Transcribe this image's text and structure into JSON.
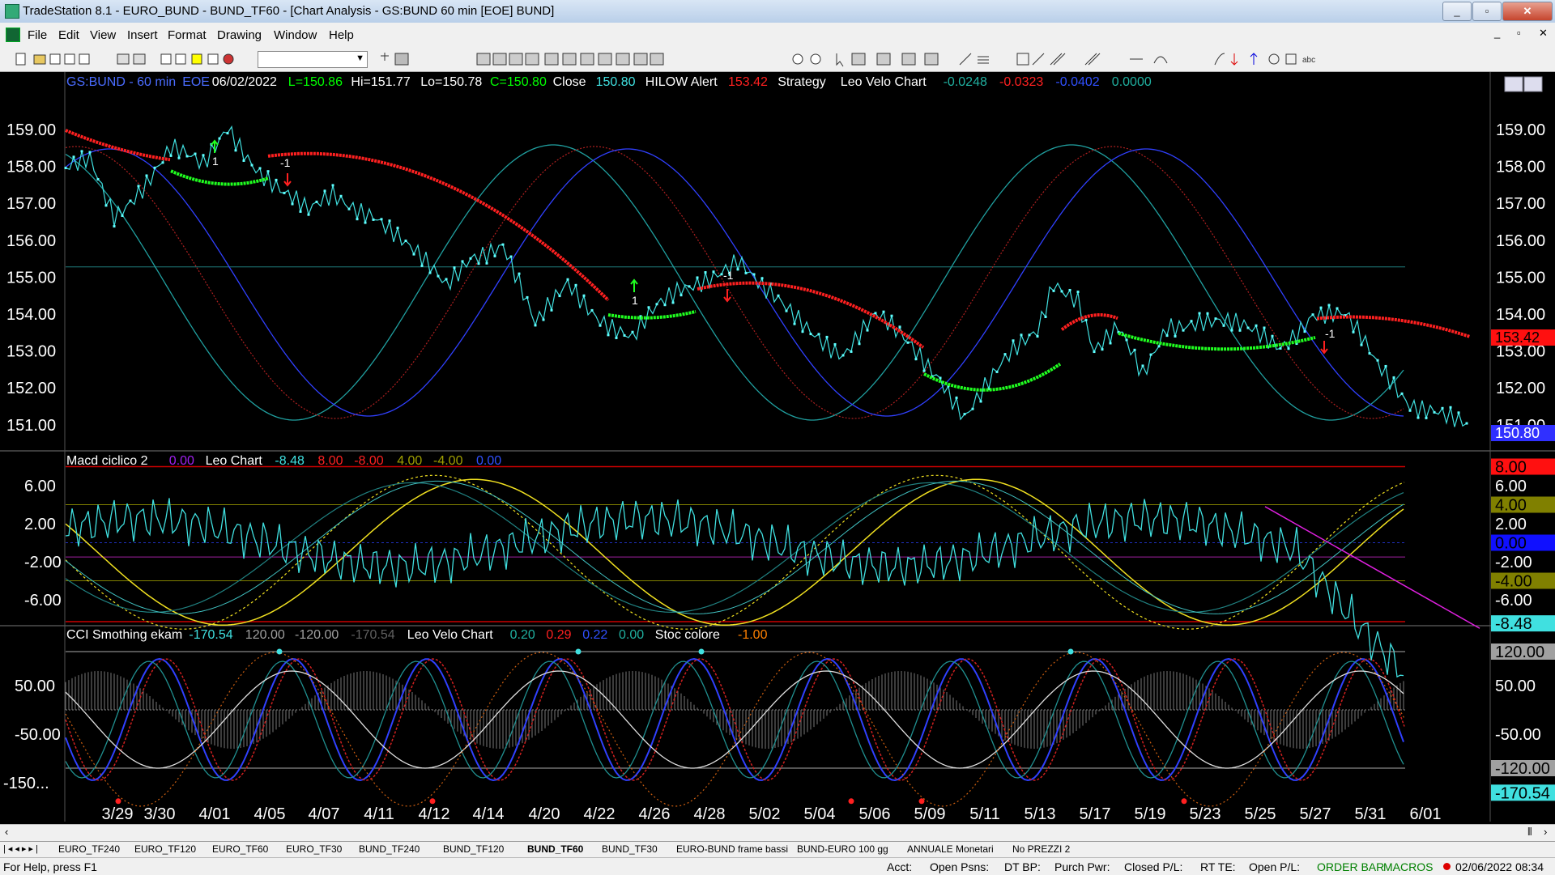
{
  "window": {
    "title": "TradeStation 8.1 - EURO_BUND - BUND_TF60 - [Chart Analysis - GS:BUND  60 min  [EOE] BUND]",
    "minimize": "_",
    "maximize": "▫",
    "close": "✕"
  },
  "menu": [
    "File",
    "Edit",
    "View",
    "Insert",
    "Format",
    "Drawing",
    "Window",
    "Help"
  ],
  "mdi_buttons": [
    "_",
    "▫",
    "✕"
  ],
  "price_panel": {
    "header": [
      {
        "text": "GS:BUND - 60 min",
        "color": "#4a6cff"
      },
      {
        "text": "EOE",
        "color": "#4a6cff"
      },
      {
        "text": "06/02/2022",
        "color": "#ffffff"
      },
      {
        "text": "L=150.86",
        "color": "#00ff00"
      },
      {
        "text": "Hi=151.77",
        "color": "#ffffff"
      },
      {
        "text": "Lo=150.78",
        "color": "#ffffff"
      },
      {
        "text": "C=150.80",
        "color": "#00ff00"
      },
      {
        "text": "Close",
        "color": "#ffffff"
      },
      {
        "text": "150.80",
        "color": "#40e0e0"
      },
      {
        "text": "HILOW Alert",
        "color": "#ffffff"
      },
      {
        "text": "153.42",
        "color": "#ff2020"
      },
      {
        "text": "Strategy",
        "color": "#ffffff"
      },
      {
        "text": "Leo Velo Chart",
        "color": "#ffffff"
      },
      {
        "text": "-0.0248",
        "color": "#20b0a0"
      },
      {
        "text": "-0.0323",
        "color": "#ff2020"
      },
      {
        "text": "-0.0402",
        "color": "#3050ff"
      },
      {
        "text": "0.0000",
        "color": "#20b0a0"
      }
    ],
    "y_ticks": [
      "159.00",
      "158.00",
      "157.00",
      "156.00",
      "155.00",
      "154.00",
      "153.00",
      "152.00",
      "151.00"
    ],
    "right_ticks": [
      "159.00",
      "158.00",
      "157.00",
      "156.00",
      "155.00",
      "154.00",
      "153.00",
      "152.00",
      "151.00"
    ],
    "badges": [
      {
        "text": "153.42",
        "bg": "#ff1010",
        "fg": "#000000"
      },
      {
        "text": "150.80",
        "bg": "#3030ff",
        "fg": "#ffffff"
      }
    ],
    "signals": [
      "-1",
      "1",
      "1",
      "-1",
      "-1"
    ]
  },
  "macd_panel": {
    "header": [
      {
        "text": "Macd ciclico 2",
        "color": "#ffffff"
      },
      {
        "text": "0.00",
        "color": "#a020f0"
      },
      {
        "text": "Leo Chart",
        "color": "#ffffff"
      },
      {
        "text": "-8.48",
        "color": "#40e0e0"
      },
      {
        "text": "8.00",
        "color": "#ff2020"
      },
      {
        "text": "-8.00",
        "color": "#ff2020"
      },
      {
        "text": "4.00",
        "color": "#a0a000"
      },
      {
        "text": "-4.00",
        "color": "#a0a000"
      },
      {
        "text": "0.00",
        "color": "#3050ff"
      }
    ],
    "y_ticks": [
      "6.00",
      "2.00",
      "-2.00",
      "-6.00"
    ],
    "badges": [
      {
        "text": "8.00",
        "bg": "#ff1010",
        "fg": "#000000"
      },
      {
        "text": "6.00",
        "bg": "#000000",
        "fg": "#ffffff"
      },
      {
        "text": "4.00",
        "bg": "#808000",
        "fg": "#000000"
      },
      {
        "text": "2.00",
        "bg": "#000000",
        "fg": "#ffffff"
      },
      {
        "text": "0.00",
        "bg": "#1010ff",
        "fg": "#000000"
      },
      {
        "text": "-2.00",
        "bg": "#000000",
        "fg": "#ffffff"
      },
      {
        "text": "-4.00",
        "bg": "#808000",
        "fg": "#000000"
      },
      {
        "text": "-6.00",
        "bg": "#000000",
        "fg": "#ffffff"
      },
      {
        "text": "-8.48",
        "bg": "#40e0e0",
        "fg": "#000000"
      }
    ]
  },
  "cci_panel": {
    "header": [
      {
        "text": "CCI Smothing ekam",
        "color": "#ffffff"
      },
      {
        "text": "-170.54",
        "color": "#40e0e0"
      },
      {
        "text": "120.00",
        "color": "#a0a0a0"
      },
      {
        "text": "-120.00",
        "color": "#a0a0a0"
      },
      {
        "text": "-170.54",
        "color": "#606060"
      },
      {
        "text": "Leo Velo Chart",
        "color": "#ffffff"
      },
      {
        "text": "0.20",
        "color": "#20b0a0"
      },
      {
        "text": "0.29",
        "color": "#ff2020"
      },
      {
        "text": "0.22",
        "color": "#3050ff"
      },
      {
        "text": "0.00",
        "color": "#20b0a0"
      },
      {
        "text": "Stoc colore",
        "color": "#ffffff"
      },
      {
        "text": "-1.00",
        "color": "#ff8000"
      }
    ],
    "y_ticks": [
      "50.00",
      "-50.00",
      "-150..."
    ],
    "badges": [
      {
        "text": "120.00",
        "bg": "#a0a0a0",
        "fg": "#000000"
      },
      {
        "text": "50.00",
        "bg": "#000000",
        "fg": "#ffffff"
      },
      {
        "text": "-50.00",
        "bg": "#000000",
        "fg": "#ffffff"
      },
      {
        "text": "-120.00",
        "bg": "#a0a0a0",
        "fg": "#000000"
      },
      {
        "text": "-170.54",
        "bg": "#40e0e0",
        "fg": "#000000"
      }
    ]
  },
  "x_axis": [
    "3/29",
    "3/30",
    "4/01",
    "4/05",
    "4/07",
    "4/11",
    "4/12",
    "4/14",
    "4/20",
    "4/22",
    "4/26",
    "4/28",
    "5/02",
    "5/04",
    "5/06",
    "5/09",
    "5/11",
    "5/13",
    "5/17",
    "5/19",
    "5/23",
    "5/25",
    "5/27",
    "5/31",
    "6/01"
  ],
  "tabs": [
    {
      "label": "EURO_TF240",
      "active": false
    },
    {
      "label": "EURO_TF120",
      "active": false
    },
    {
      "label": "EURO_TF60",
      "active": false
    },
    {
      "label": "EURO_TF30",
      "active": false
    },
    {
      "label": "BUND_TF240",
      "active": false
    },
    {
      "label": "BUND_TF120",
      "active": false
    },
    {
      "label": "BUND_TF60",
      "active": true
    },
    {
      "label": "BUND_TF30",
      "active": false
    },
    {
      "label": "EURO-BUND frame bassi",
      "active": false
    },
    {
      "label": "BUND-EURO 100 gg",
      "active": false
    },
    {
      "label": "ANNUALE Monetari",
      "active": false
    },
    {
      "label": "No PREZZI 2",
      "active": false
    }
  ],
  "status": {
    "help": "For Help, press F1",
    "acct": "Acct:",
    "open_psns": "Open Psns:",
    "dt_bp": "DT BP:",
    "purch_pwr": "Purch Pwr:",
    "closed_pl": "Closed P/L:",
    "rt_te": "RT TE:",
    "open_pl": "Open P/L:",
    "order_bar": "ORDER BAR",
    "macros": "MACROS",
    "datetime": "02/06/2022 08:34"
  }
}
